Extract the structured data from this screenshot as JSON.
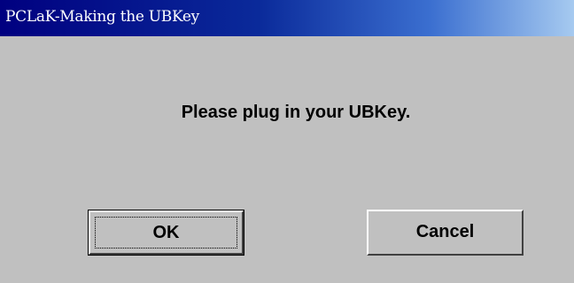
{
  "window": {
    "title": "PCLaK-Making the UBKey"
  },
  "dialog": {
    "message": "Please plug in your UBKey."
  },
  "buttons": {
    "ok_label": "OK",
    "cancel_label": "Cancel"
  },
  "colors": {
    "titlebar_start": "#000080",
    "titlebar_end": "#a6caf0",
    "dialog_background": "#c0c0c0",
    "title_text": "#ffffff"
  }
}
